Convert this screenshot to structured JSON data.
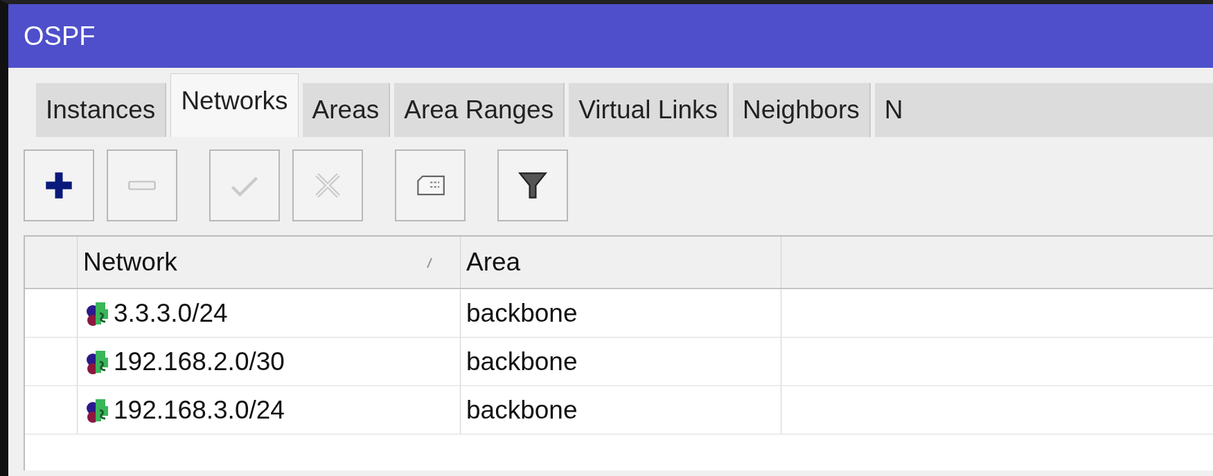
{
  "window": {
    "title": "OSPF"
  },
  "tabs": [
    {
      "label": "Instances",
      "selected": false
    },
    {
      "label": "Networks",
      "selected": true
    },
    {
      "label": "Areas",
      "selected": false
    },
    {
      "label": "Area Ranges",
      "selected": false
    },
    {
      "label": "Virtual Links",
      "selected": false
    },
    {
      "label": "Neighbors",
      "selected": false
    },
    {
      "label": "N",
      "selected": false
    }
  ],
  "toolbar": [
    {
      "kind": "add",
      "disabled": false
    },
    {
      "kind": "remove",
      "disabled": true
    },
    {
      "kind": "enable",
      "disabled": true
    },
    {
      "kind": "disable",
      "disabled": true
    },
    {
      "kind": "comment",
      "disabled": false
    },
    {
      "kind": "filter",
      "disabled": false
    }
  ],
  "table": {
    "columns": [
      {
        "label": "Network",
        "sorted": true
      },
      {
        "label": "Area",
        "sorted": false
      }
    ],
    "rows": [
      {
        "network": "3.3.3.0/24",
        "area": "backbone"
      },
      {
        "network": "192.168.2.0/30",
        "area": "backbone"
      },
      {
        "network": "192.168.3.0/24",
        "area": "backbone"
      }
    ]
  }
}
